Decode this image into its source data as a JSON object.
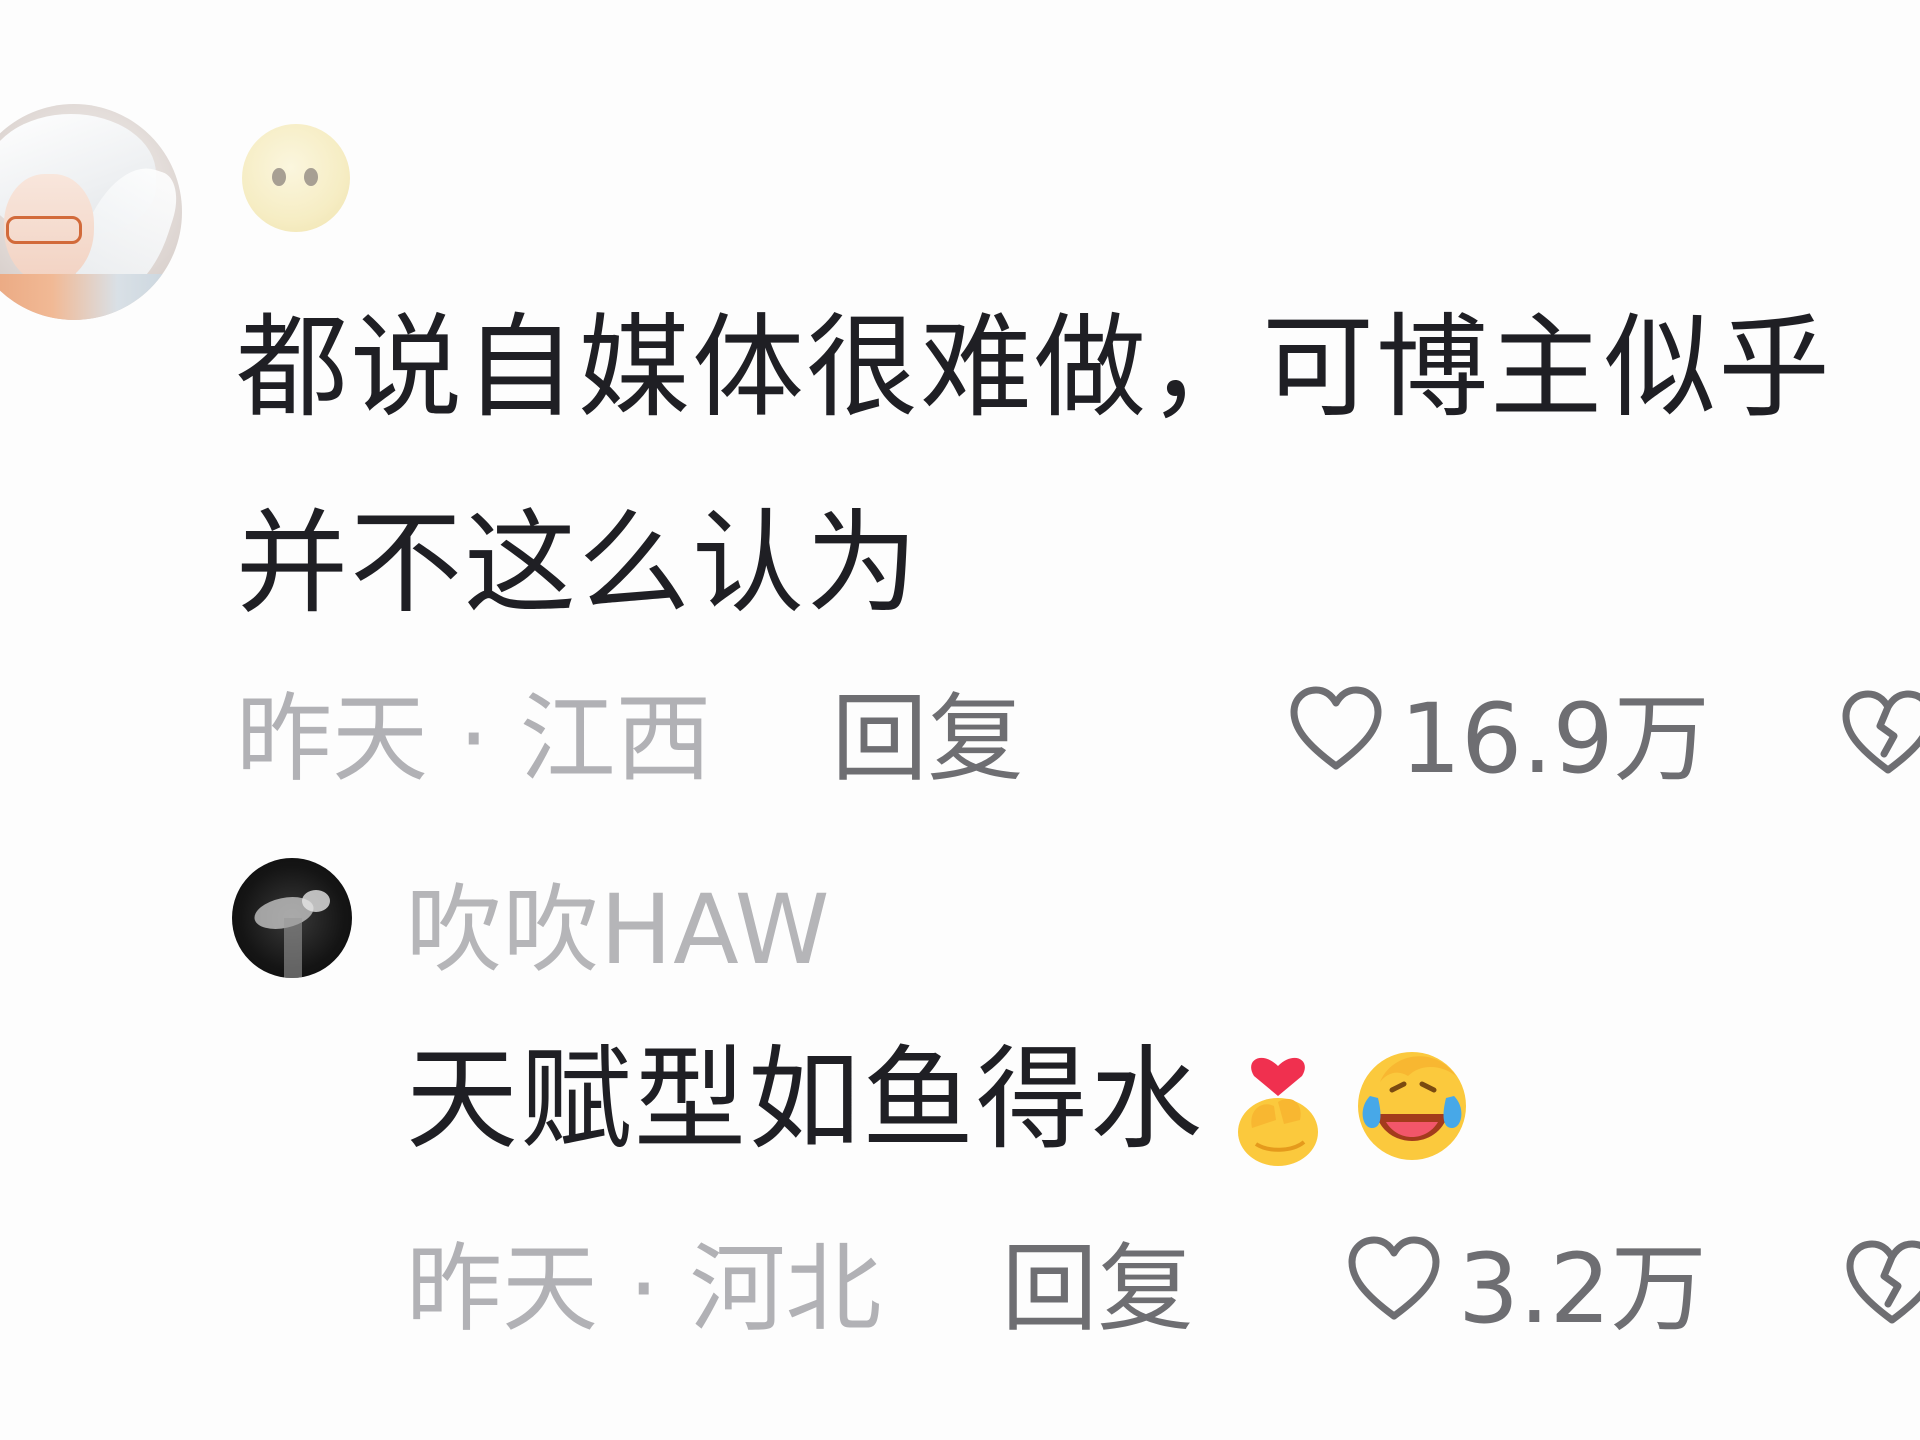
{
  "comment": {
    "avatar_icon": "user-avatar-anime-icon",
    "name_icon": "neutral-face-emoji-icon",
    "text": "都说自媒体很难做，可博主似乎\n并不这么认为",
    "time_location": "昨天 · 江西",
    "reply_label": "回复",
    "like_count": "16.9万",
    "like_icon": "heart-outline-icon",
    "dislike_icon": "broken-heart-icon"
  },
  "reply": {
    "avatar_icon": "user-avatar-dark-icon",
    "username": "吹吹HAW",
    "text": "天赋型如鱼得水",
    "emojis": [
      "finger-heart-emoji-icon",
      "laughing-crying-emoji-icon"
    ],
    "time_location": "昨天 · 河北",
    "reply_label": "回复",
    "like_count": "3.2万",
    "like_icon": "heart-outline-icon",
    "dislike_icon": "broken-heart-icon"
  },
  "colors": {
    "background": "#fdfdfd",
    "primary_text": "#1f1f24",
    "muted_text": "#b1b1b5",
    "action_text": "#6e6e72"
  }
}
